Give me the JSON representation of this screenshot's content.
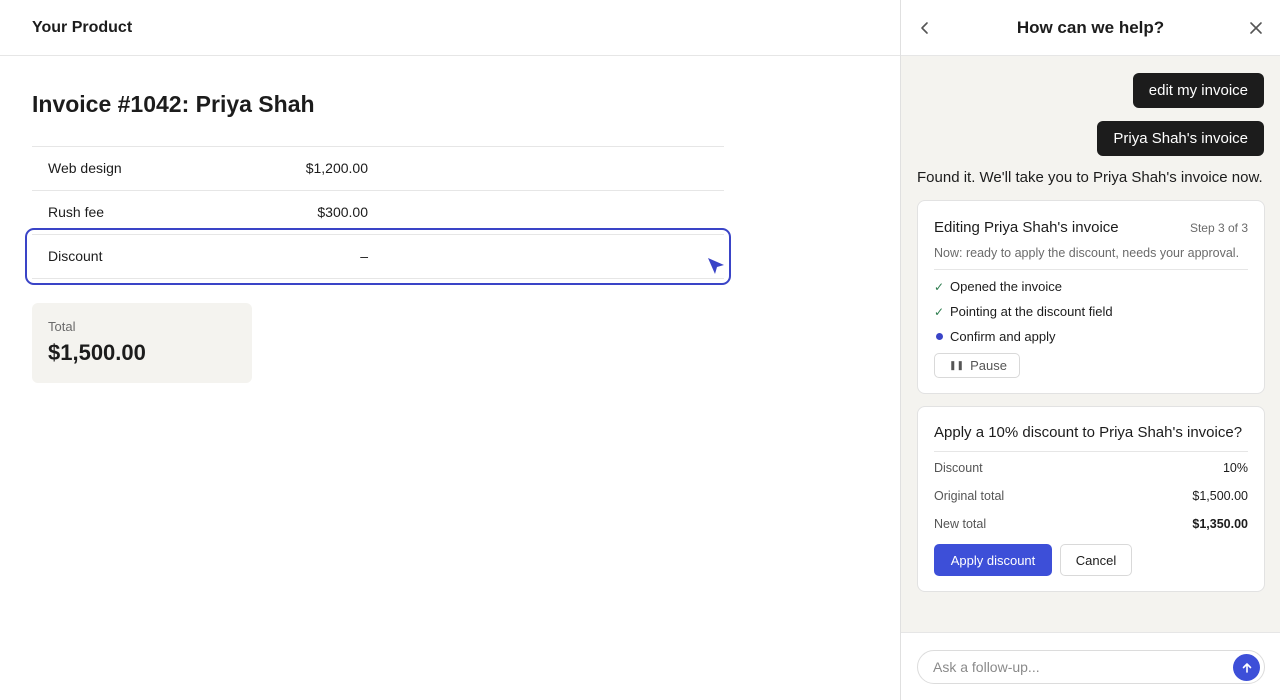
{
  "app": {
    "brand": "Your Product",
    "invoice_title": "Invoice #1042: Priya Shah",
    "line_items": [
      {
        "label": "Web design",
        "amount": "$1,200.00"
      },
      {
        "label": "Rush fee",
        "amount": "$300.00"
      },
      {
        "label": "Discount",
        "amount": "–"
      }
    ],
    "total": {
      "label": "Total",
      "value": "$1,500.00"
    }
  },
  "help_panel": {
    "title": "How can we help?",
    "messages": {
      "user_1": "edit my invoice",
      "user_2": "Priya Shah's invoice",
      "bot_1": "Found it. We'll take you to Priya Shah's invoice now."
    },
    "progress": {
      "title": "Editing Priya Shah's invoice",
      "step_info": "Step 3 of 3",
      "subtitle": "Now: ready to apply the discount, needs your approval.",
      "steps": [
        {
          "label": "Opened the invoice",
          "status": "done"
        },
        {
          "label": "Pointing at the discount field",
          "status": "done"
        },
        {
          "label": "Confirm and apply",
          "status": "current"
        }
      ],
      "pause_label": "Pause"
    },
    "confirm": {
      "title": "Apply a 10% discount to Priya Shah's invoice?",
      "rows": [
        {
          "label": "Discount",
          "value": "10%"
        },
        {
          "label": "Original total",
          "value": "$1,500.00"
        },
        {
          "label": "New total",
          "value": "$1,350.00"
        }
      ],
      "apply_label": "Apply discount",
      "cancel_label": "Cancel"
    },
    "composer": {
      "placeholder": "Ask a follow-up..."
    }
  },
  "colors": {
    "accent": "#3d4fd8",
    "highlight_ring": "#3a44c7",
    "check": "#2e7d4f",
    "user_bubble": "#1c1c1c",
    "panel_bg": "#f4f3ef"
  },
  "icons": [
    "back-chevron-icon",
    "close-icon",
    "cursor-pointer-icon",
    "check-icon",
    "pause-icon",
    "send-arrow-icon"
  ]
}
